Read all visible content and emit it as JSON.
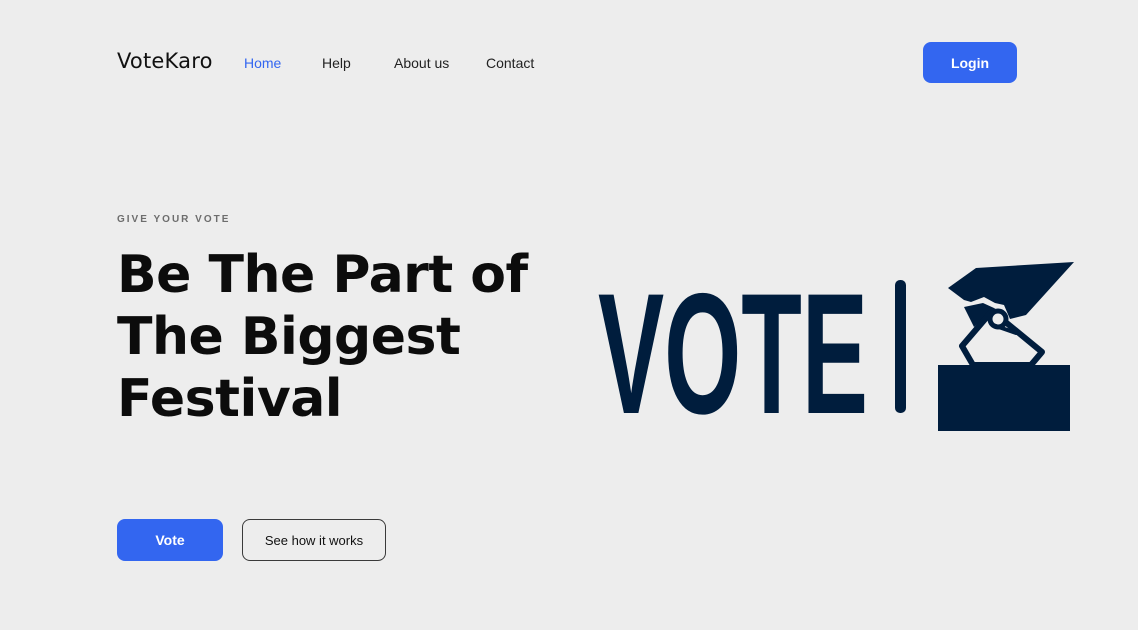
{
  "nav": {
    "brand": "VoteKaro",
    "links": [
      {
        "label": "Home",
        "active": true
      },
      {
        "label": "Help",
        "active": false
      },
      {
        "label": "About us",
        "active": false
      },
      {
        "label": "Contact",
        "active": false
      }
    ],
    "login_label": "Login"
  },
  "hero": {
    "eyebrow": "GIVE YOUR VOTE",
    "headline_lines": [
      "Be The Part of",
      "The Biggest",
      "Festival"
    ],
    "primary_cta": "Vote",
    "secondary_cta": "See how it works",
    "illustration": {
      "text": "VOTE",
      "icon": "ballot-box-icon",
      "color": "#001d3d"
    }
  },
  "colors": {
    "accent": "#3366f0",
    "background": "#ededed",
    "illustration_navy": "#001d3d"
  }
}
